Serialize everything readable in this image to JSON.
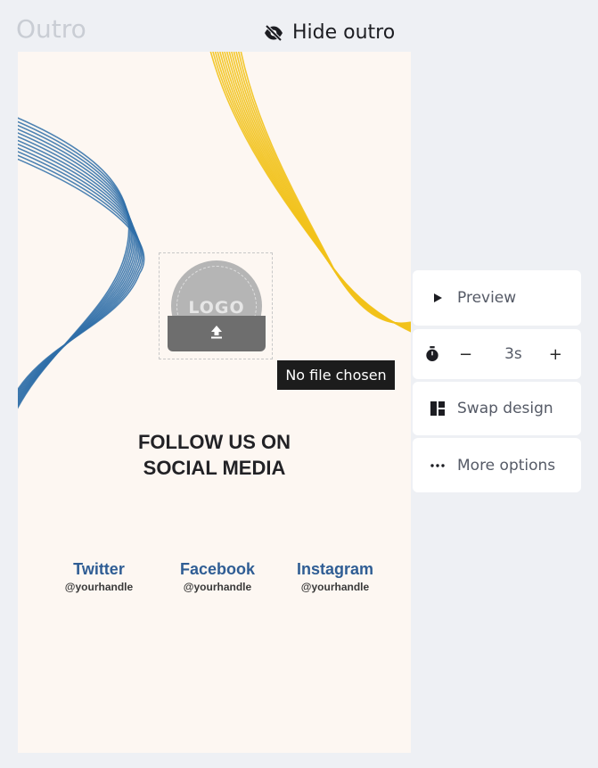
{
  "header": {
    "section_title": "Outro",
    "hide_outro_label": "Hide outro"
  },
  "canvas": {
    "background_color": "#fdf7f2",
    "logo_placeholder_text": "LOGO",
    "heading_line1": "FOLLOW US ON",
    "heading_line2": "SOCIAL MEDIA",
    "socials": [
      {
        "name": "Twitter",
        "handle": "@yourhandle"
      },
      {
        "name": "Facebook",
        "handle": "@yourhandle"
      },
      {
        "name": "Instagram",
        "handle": "@yourhandle"
      }
    ],
    "wave_colors": {
      "blue": "#2f6ea8",
      "yellow": "#f2c21b"
    }
  },
  "upload_tooltip": "No file chosen",
  "side_panel": {
    "preview_label": "Preview",
    "duration_value": "3s",
    "decrease_symbol": "−",
    "increase_symbol": "+",
    "swap_design_label": "Swap design",
    "more_options_label": "More options"
  }
}
